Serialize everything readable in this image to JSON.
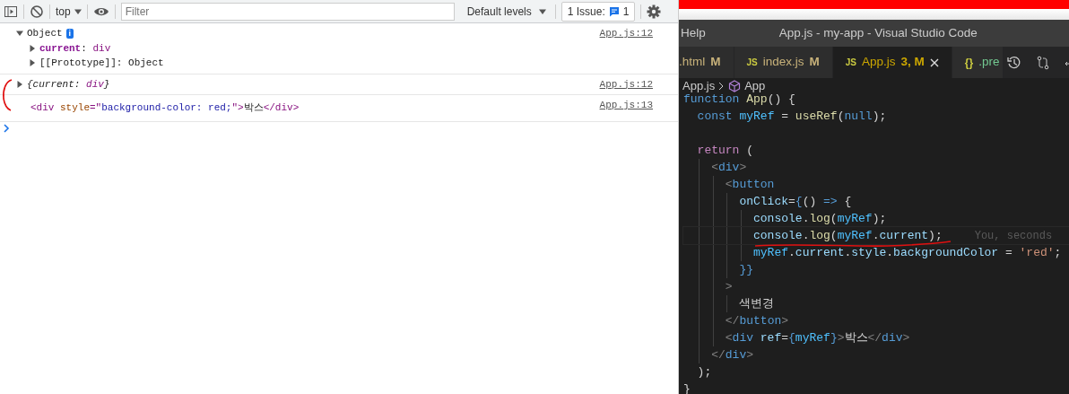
{
  "devtools": {
    "toolbar": {
      "context": "top",
      "filter": {
        "placeholder": "Filter"
      },
      "levels": "Default levels",
      "issues": {
        "label": "1 Issue:",
        "count": "1"
      }
    },
    "messages": [
      {
        "kind": "object",
        "expanded": true,
        "label": "Object",
        "badge": "i",
        "source": "App.js:12",
        "children": [
          {
            "expanded": false,
            "tokens": [
              {
                "text": "current",
                "kind": "key"
              },
              {
                "text": ":",
                "kind": "plain"
              },
              {
                "text": "div",
                "kind": "val"
              }
            ]
          },
          {
            "expanded": false,
            "tokens": [
              {
                "text": "[[Prototype]]",
                "kind": "plain"
              },
              {
                "text": ":",
                "kind": "plain"
              },
              {
                "text": "Object",
                "kind": "plain"
              }
            ]
          }
        ]
      },
      {
        "kind": "preview",
        "expanded": false,
        "tokens": [
          {
            "text": "{current:",
            "kind": "plain"
          },
          {
            "text": "div",
            "kind": "val"
          },
          {
            "text": "}",
            "kind": "plain"
          }
        ],
        "source": "App.js:12"
      },
      {
        "kind": "element",
        "tokens": [
          {
            "text": "<div",
            "kind": "tag"
          },
          {
            "text": " style",
            "kind": "attr"
          },
          {
            "text": "=\"",
            "kind": "tag"
          },
          {
            "text": "background-color: red;",
            "kind": "aval"
          },
          {
            "text": "\">",
            "kind": "tag"
          },
          {
            "text": "박스",
            "kind": "plain"
          },
          {
            "text": "</div>",
            "kind": "tag"
          }
        ],
        "source": "App.js:13"
      }
    ]
  },
  "editor": {
    "menu": "Help",
    "title": "App.js - my-app - Visual Studio Code",
    "tabs": [
      {
        "label": ".html",
        "status": "M",
        "color": "#c8b27a",
        "selected": false,
        "closable": false
      },
      {
        "icon": "JS",
        "label": "index.js",
        "status": "M",
        "color": "#c8b27a",
        "selected": false,
        "closable": false
      },
      {
        "icon": "JS",
        "label": "App.js",
        "status": "3, M",
        "color": "#cca700",
        "selected": true,
        "closable": true
      },
      {
        "icon": "{}",
        "label": ".pre",
        "color": "#73c991",
        "selected": false,
        "closable": false
      }
    ],
    "breadcrumb": [
      "App.js",
      "App"
    ],
    "lines": [
      {
        "kind": "code",
        "tokens": [
          {
            "text": "function ",
            "kind": "kw"
          },
          {
            "text": "App",
            "kind": "fn"
          },
          {
            "text": "() {",
            "kind": "p"
          }
        ]
      },
      {
        "kind": "code",
        "tokens": [
          {
            "text": "  const ",
            "kind": "kw"
          },
          {
            "text": "myRef",
            "kind": "const"
          },
          {
            "text": " = ",
            "kind": "p"
          },
          {
            "text": "useRef",
            "kind": "fn"
          },
          {
            "text": "(",
            "kind": "p"
          },
          {
            "text": "null",
            "kind": "kw"
          },
          {
            "text": ");",
            "kind": "p"
          }
        ]
      },
      {
        "kind": "blank"
      },
      {
        "kind": "code",
        "tokens": [
          {
            "text": "  return",
            "kind": "ctl"
          },
          {
            "text": " (",
            "kind": "p"
          }
        ]
      },
      {
        "kind": "code",
        "tokens": [
          {
            "text": "    <",
            "kind": "br"
          },
          {
            "text": "div",
            "kind": "kw"
          },
          {
            "text": ">",
            "kind": "br"
          }
        ]
      },
      {
        "kind": "code",
        "tokens": [
          {
            "text": "      <",
            "kind": "br"
          },
          {
            "text": "button",
            "kind": "kw"
          }
        ]
      },
      {
        "kind": "code",
        "tokens": [
          {
            "text": "        onClick",
            "kind": "var"
          },
          {
            "text": "=",
            "kind": "p"
          },
          {
            "text": "{",
            "kind": "kw"
          },
          {
            "text": "() ",
            "kind": "p"
          },
          {
            "text": "=>",
            "kind": "kw"
          },
          {
            "text": " {",
            "kind": "p"
          }
        ]
      },
      {
        "kind": "code",
        "tokens": [
          {
            "text": "          console",
            "kind": "var"
          },
          {
            "text": ".",
            "kind": "p"
          },
          {
            "text": "log",
            "kind": "fn"
          },
          {
            "text": "(",
            "kind": "p"
          },
          {
            "text": "myRef",
            "kind": "const"
          },
          {
            "text": ");",
            "kind": "p"
          }
        ]
      },
      {
        "kind": "code",
        "tokens": [
          {
            "text": "          console",
            "kind": "var"
          },
          {
            "text": ".",
            "kind": "p"
          },
          {
            "text": "log",
            "kind": "fn"
          },
          {
            "text": "(",
            "kind": "p"
          },
          {
            "text": "myRef",
            "kind": "const"
          },
          {
            "text": ".",
            "kind": "p"
          },
          {
            "text": "current",
            "kind": "var"
          },
          {
            "text": ");",
            "kind": "p"
          }
        ],
        "blame": "You, seconds",
        "current": true
      },
      {
        "kind": "code",
        "tokens": [
          {
            "text": "          myRef",
            "kind": "const"
          },
          {
            "text": ".",
            "kind": "p"
          },
          {
            "text": "current",
            "kind": "var"
          },
          {
            "text": ".",
            "kind": "p"
          },
          {
            "text": "style",
            "kind": "var"
          },
          {
            "text": ".",
            "kind": "p"
          },
          {
            "text": "backgroundColor",
            "kind": "var"
          },
          {
            "text": " = ",
            "kind": "p"
          },
          {
            "text": "'red'",
            "kind": "str"
          },
          {
            "text": ";",
            "kind": "p"
          }
        ]
      },
      {
        "kind": "code",
        "tokens": [
          {
            "text": "        }}",
            "kind": "kw"
          }
        ]
      },
      {
        "kind": "code",
        "tokens": [
          {
            "text": "      >",
            "kind": "br"
          }
        ]
      },
      {
        "kind": "code",
        "tokens": [
          {
            "text": "        색변경",
            "kind": "p"
          }
        ]
      },
      {
        "kind": "code",
        "tokens": [
          {
            "text": "      </",
            "kind": "br"
          },
          {
            "text": "button",
            "kind": "kw"
          },
          {
            "text": ">",
            "kind": "br"
          }
        ]
      },
      {
        "kind": "code",
        "tokens": [
          {
            "text": "      <",
            "kind": "br"
          },
          {
            "text": "div",
            "kind": "kw"
          },
          {
            "text": " ref",
            "kind": "var"
          },
          {
            "text": "=",
            "kind": "p"
          },
          {
            "text": "{",
            "kind": "kw"
          },
          {
            "text": "myRef",
            "kind": "const"
          },
          {
            "text": "}",
            "kind": "kw"
          },
          {
            "text": ">",
            "kind": "br"
          },
          {
            "text": "박스",
            "kind": "p"
          },
          {
            "text": "</",
            "kind": "br"
          },
          {
            "text": "div",
            "kind": "kw"
          },
          {
            "text": ">",
            "kind": "br"
          }
        ]
      },
      {
        "kind": "code",
        "tokens": [
          {
            "text": "    </",
            "kind": "br"
          },
          {
            "text": "div",
            "kind": "kw"
          },
          {
            "text": ">",
            "kind": "br"
          }
        ]
      },
      {
        "kind": "code",
        "tokens": [
          {
            "text": "  );",
            "kind": "p"
          }
        ]
      },
      {
        "kind": "code",
        "tokens": [
          {
            "text": "}",
            "kind": "p"
          }
        ]
      }
    ]
  }
}
